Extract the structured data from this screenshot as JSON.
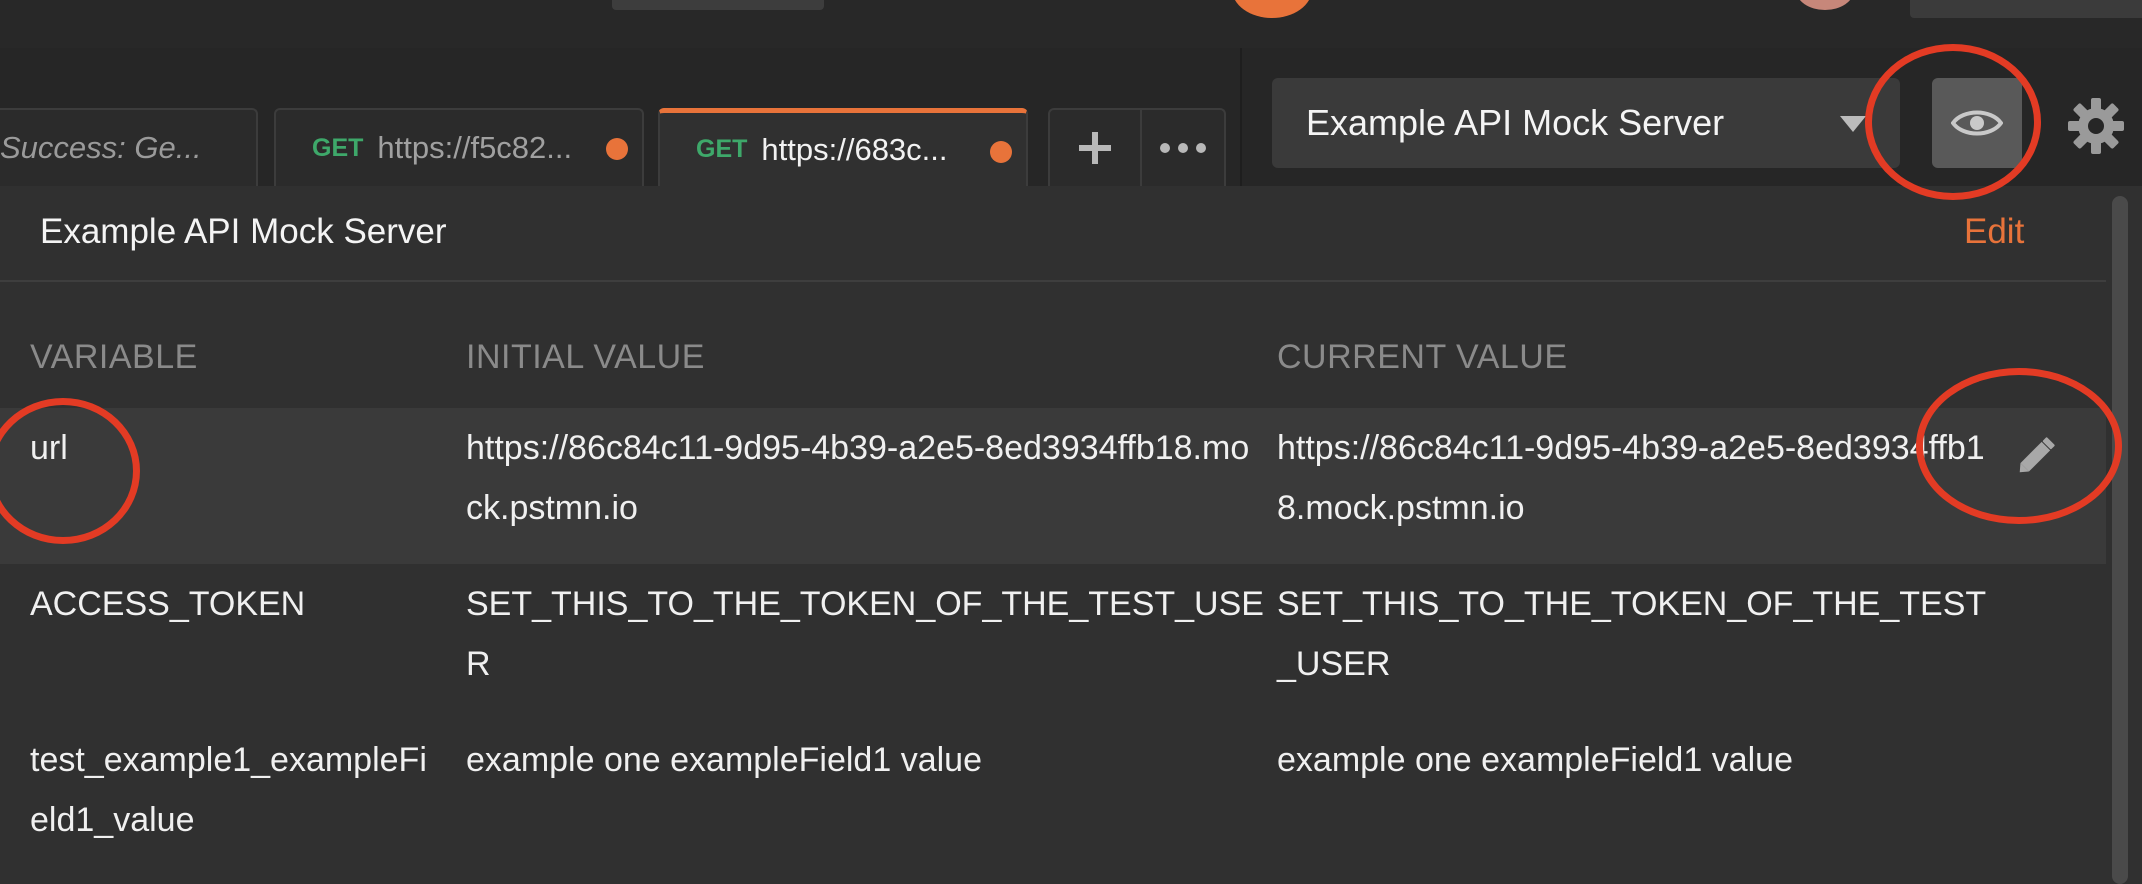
{
  "tabs": [
    {
      "name": "Success: Ge..."
    },
    {
      "method": "GET",
      "url": "https://f5c82..."
    },
    {
      "method": "GET",
      "url": "https://683c..."
    }
  ],
  "toolbar": {
    "new_tab_icon": "plus-icon",
    "more_icon": "ellipsis-icon"
  },
  "environment": {
    "selected": "Example API Mock Server",
    "quick_look_icon": "eye-icon",
    "settings_icon": "gear-icon"
  },
  "panel": {
    "title": "Example API Mock Server",
    "edit_label": "Edit",
    "columns": [
      "VARIABLE",
      "INITIAL VALUE",
      "CURRENT VALUE"
    ],
    "rows": [
      {
        "variable": "url",
        "initial": "https://86c84c11-9d95-4b39-a2e5-8ed3934ffb18.mock.pstmn.io",
        "current": "https://86c84c11-9d95-4b39-a2e5-8ed3934ffb18.mock.pstmn.io"
      },
      {
        "variable": "ACCESS_TOKEN",
        "initial": "SET_THIS_TO_THE_TOKEN_OF_THE_TEST_USER",
        "current": "SET_THIS_TO_THE_TOKEN_OF_THE_TEST_USER"
      },
      {
        "variable": "test_example1_exampleField1_value",
        "initial": "example one exampleField1 value",
        "current": "example one exampleField1 value"
      }
    ]
  },
  "colors": {
    "accent": "#e8733a",
    "annotation": "#e33b24",
    "method_get": "#3ea86a"
  }
}
